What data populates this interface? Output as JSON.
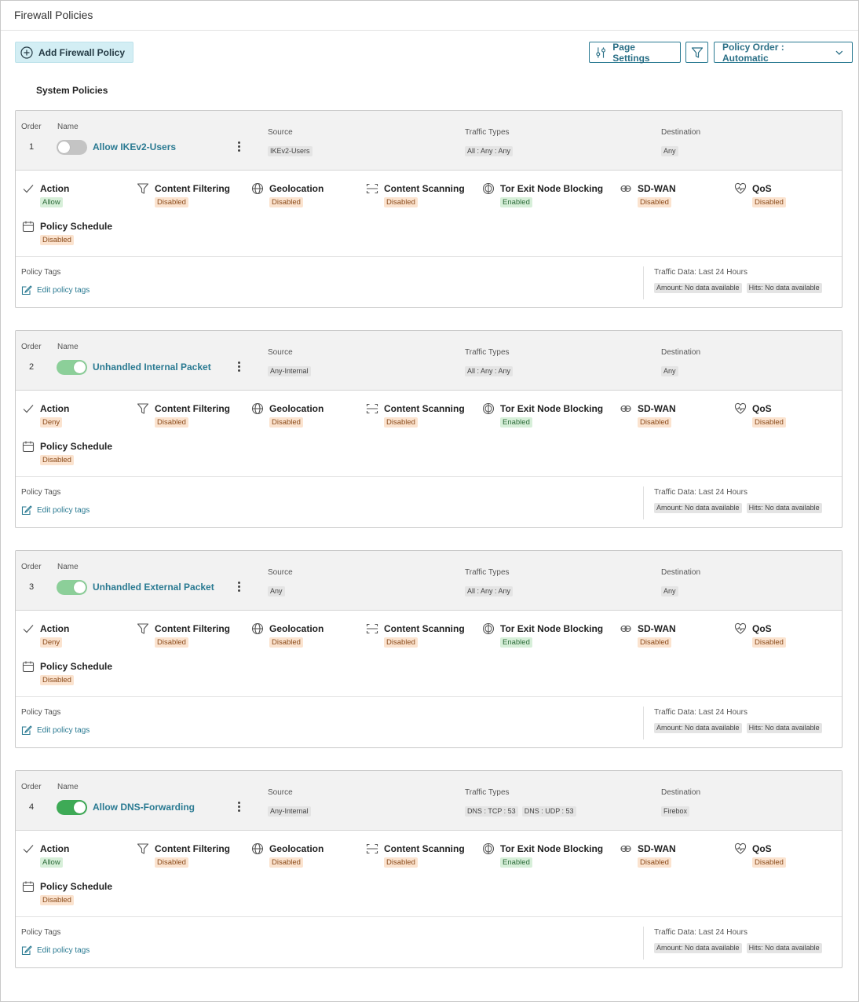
{
  "page": {
    "title": "Firewall Policies"
  },
  "toolbar": {
    "add_label": "Add Firewall Policy",
    "page_settings_label": "Page Settings",
    "policy_order_label": "Policy Order : Automatic"
  },
  "section_title": "System Policies",
  "labels": {
    "order": "Order",
    "name": "Name",
    "source": "Source",
    "traffic_types": "Traffic Types",
    "destination": "Destination",
    "action": "Action",
    "content_filtering": "Content Filtering",
    "geolocation": "Geolocation",
    "content_scanning": "Content Scanning",
    "tor_blocking": "Tor Exit Node Blocking",
    "sdwan": "SD-WAN",
    "qos": "QoS",
    "policy_schedule": "Policy Schedule",
    "policy_tags": "Policy Tags",
    "edit_policy_tags": "Edit policy tags",
    "traffic_data": "Traffic Data: Last 24 Hours",
    "amount": "Amount: No data available",
    "hits": "Hits: No data available"
  },
  "policies": [
    {
      "order": "1",
      "name": "Allow IKEv2-Users",
      "enabled": false,
      "source": "IKEv2-Users",
      "traffic_types": [
        "All : Any : Any"
      ],
      "destination": "Any",
      "action": "Allow",
      "content_filtering": "Disabled",
      "geolocation": "Disabled",
      "content_scanning": "Disabled",
      "tor_blocking": "Enabled",
      "sdwan": "Disabled",
      "qos": "Disabled",
      "policy_schedule": "Disabled"
    },
    {
      "order": "2",
      "name": "Unhandled Internal Packet",
      "enabled": true,
      "source": "Any-Internal",
      "traffic_types": [
        "All : Any : Any"
      ],
      "destination": "Any",
      "action": "Deny",
      "content_filtering": "Disabled",
      "geolocation": "Disabled",
      "content_scanning": "Disabled",
      "tor_blocking": "Enabled",
      "sdwan": "Disabled",
      "qos": "Disabled",
      "policy_schedule": "Disabled"
    },
    {
      "order": "3",
      "name": "Unhandled External Packet",
      "enabled": true,
      "source": "Any",
      "traffic_types": [
        "All : Any : Any"
      ],
      "destination": "Any",
      "action": "Deny",
      "content_filtering": "Disabled",
      "geolocation": "Disabled",
      "content_scanning": "Disabled",
      "tor_blocking": "Enabled",
      "sdwan": "Disabled",
      "qos": "Disabled",
      "policy_schedule": "Disabled"
    },
    {
      "order": "4",
      "name": "Allow DNS-Forwarding",
      "enabled": true,
      "source": "Any-Internal",
      "traffic_types": [
        "DNS : TCP : 53",
        "DNS : UDP : 53"
      ],
      "destination": "Firebox",
      "action": "Allow",
      "content_filtering": "Disabled",
      "geolocation": "Disabled",
      "content_scanning": "Disabled",
      "tor_blocking": "Enabled",
      "sdwan": "Disabled",
      "qos": "Disabled",
      "policy_schedule": "Disabled"
    }
  ],
  "colors": {
    "accent": "#2a7a92",
    "toggle_off": "#c4c4c4",
    "toggle_on": "#3eaa56",
    "toggle_on_faded": "#8ccf99",
    "disabled_badge": "#fbe3cf",
    "enabled_badge": "#d7efd9"
  }
}
